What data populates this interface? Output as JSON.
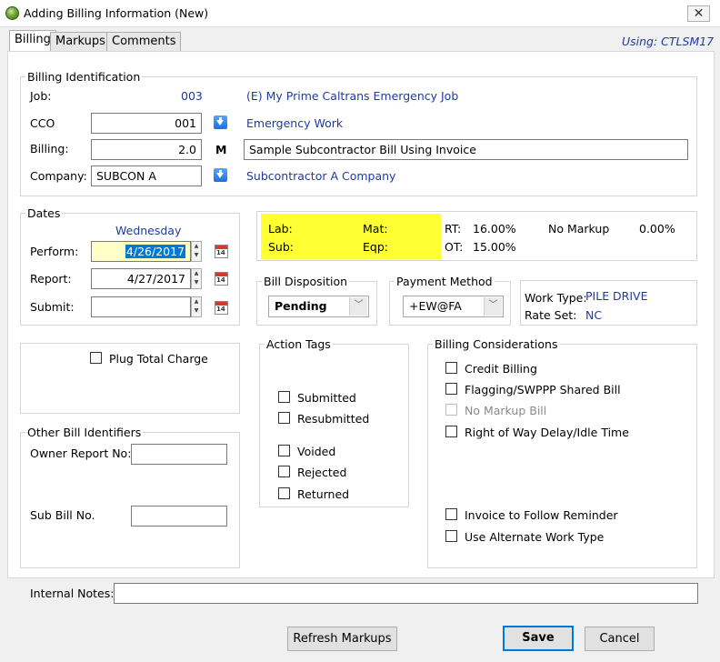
{
  "window": {
    "title": "Adding Billing Information  (New)",
    "close_glyph": "✕"
  },
  "tabs": [
    "Billing",
    "Markups",
    "Comments"
  ],
  "using": "Using: CTLSM17",
  "billing_identification": {
    "group_label": "Billing Identification",
    "job_label": "Job:",
    "job_value": "003",
    "job_name": "(E) My Prime Caltrans Emergency Job",
    "cco_label": "CCO",
    "cco_value": "001",
    "cco_name": "Emergency Work",
    "billing_label": "Billing:",
    "billing_value": "2.0",
    "billing_m": "M",
    "billing_desc": "Sample Subcontractor Bill Using Invoice",
    "company_label": "Company:",
    "company_value": "SUBCON A",
    "company_name": "Subcontractor A Company"
  },
  "dates": {
    "group_label": "Dates",
    "weekday": "Wednesday",
    "perform_label": "Perform:",
    "perform_value": "4/26/2017",
    "report_label": "Report:",
    "report_value": "4/27/2017",
    "submit_label": "Submit:",
    "submit_value": ""
  },
  "summary": {
    "lab": "Lab:",
    "mat": "Mat:",
    "sub": "Sub:",
    "eqp": "Eqp:",
    "rt_label": "RT:",
    "rt_value": "16.00%",
    "ot_label": "OT:",
    "ot_value": "15.00%",
    "no_markup_label": "No Markup",
    "no_markup_value": "0.00%"
  },
  "bill_disposition": {
    "group_label": "Bill Disposition",
    "value": "Pending"
  },
  "payment_method": {
    "group_label": "Payment Method",
    "value": "+EW@FA"
  },
  "work_type": {
    "label": "Work Type:",
    "value": "PILE DRIVE",
    "rate_label": "Rate Set:",
    "rate_value": "NC"
  },
  "plug_total_charge": "Plug Total Charge",
  "other_bill_identifiers": {
    "group_label": "Other Bill Identifiers",
    "owner_report_label": "Owner Report No:",
    "owner_report_value": "",
    "sub_bill_label": "Sub Bill No.",
    "sub_bill_value": ""
  },
  "action_tags": {
    "group_label": "Action Tags",
    "submitted": "Submitted",
    "resubmitted": "Resubmitted",
    "voided": "Voided",
    "rejected": "Rejected",
    "returned": "Returned"
  },
  "billing_considerations": {
    "group_label": "Billing Considerations",
    "credit_billing": "Credit Billing",
    "flagging": "Flagging/SWPPP Shared Bill",
    "no_markup_bill": "No Markup Bill",
    "right_of_way": "Right of Way Delay/Idle Time",
    "invoice_reminder": "Invoice to Follow Reminder",
    "alternate_work_type": "Use Alternate Work Type"
  },
  "internal_notes": {
    "label": "Internal Notes:",
    "value": ""
  },
  "buttons": {
    "refresh": "Refresh Markups",
    "save": "Save",
    "cancel": "Cancel"
  },
  "colors": {
    "highlight": "#ffff33",
    "link": "#1f3aa0",
    "accent": "#0078d7"
  }
}
